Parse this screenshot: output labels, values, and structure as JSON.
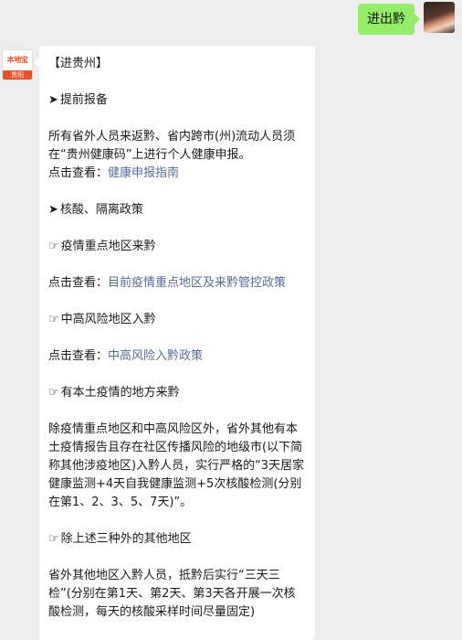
{
  "user_message": {
    "text": "进出黔"
  },
  "bot": {
    "avatar": {
      "logo_text": "本地宝",
      "city_text": "贵阳"
    },
    "heading": "【进贵州】",
    "section1": {
      "marker": "➤",
      "title": "提前报备",
      "body": "所有省外人员来返黔、省内跨市(州)流动人员须在“贵州健康码”上进行个人健康申报。",
      "link_prefix": "点击查看：",
      "link_text": "健康申报指南"
    },
    "section2": {
      "marker": "➤",
      "title": "核酸、隔离政策",
      "items": [
        {
          "icon": "☞",
          "title": "疫情重点地区来黔",
          "link_prefix": "点击查看：",
          "link_text": "目前疫情重点地区及来黔管控政策"
        },
        {
          "icon": "☞",
          "title": "中高风险地区入黔",
          "link_prefix": "点击查看：",
          "link_text": "中高风险入黔政策"
        },
        {
          "icon": "☞",
          "title": "有本土疫情的地方来黔",
          "body": "除疫情重点地区和中高风险区外，省外其他有本土疫情报告且存在社区传播风险的地级市(以下简称其他涉疫地区)入黔人员，实行严格的“3天居家健康监测+4天自我健康监测+5次核酸检测(分别在第1、2、3、5、7天)”。"
        },
        {
          "icon": "☞",
          "title": "除上述三种外的其他地区",
          "body": "省外其他地区入黔人员，抵黔后实行“三天三检”(分别在第1天、第2天、第3天各开展一次核酸检测，每天的核酸采样时间尽量固定)"
        }
      ]
    }
  }
}
